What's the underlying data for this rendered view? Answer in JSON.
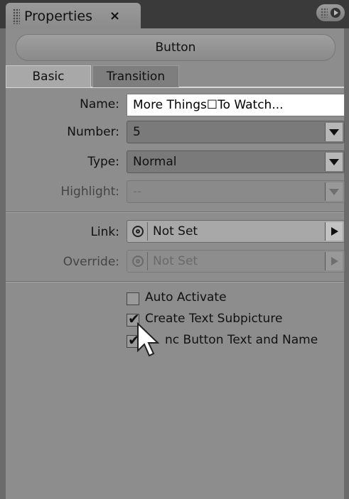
{
  "panel_tab": {
    "title": "Properties",
    "close": "×"
  },
  "object_type": "Button",
  "tabs": [
    "Basic",
    "Transition"
  ],
  "fields": {
    "name": {
      "label": "Name:",
      "value": "More Things☐To Watch..."
    },
    "number": {
      "label": "Number:",
      "value": "5"
    },
    "type": {
      "label": "Type:",
      "value": "Normal"
    },
    "highlight": {
      "label": "Highlight:",
      "value": "--"
    },
    "link": {
      "label": "Link:",
      "value": "Not Set"
    },
    "override": {
      "label": "Override:",
      "value": "Not Set"
    }
  },
  "checkboxes": [
    {
      "label": "Auto Activate",
      "checked": false
    },
    {
      "label": "Create Text Subpicture",
      "checked": true
    },
    {
      "label": "nc Button Text and Name",
      "checked": true
    }
  ]
}
